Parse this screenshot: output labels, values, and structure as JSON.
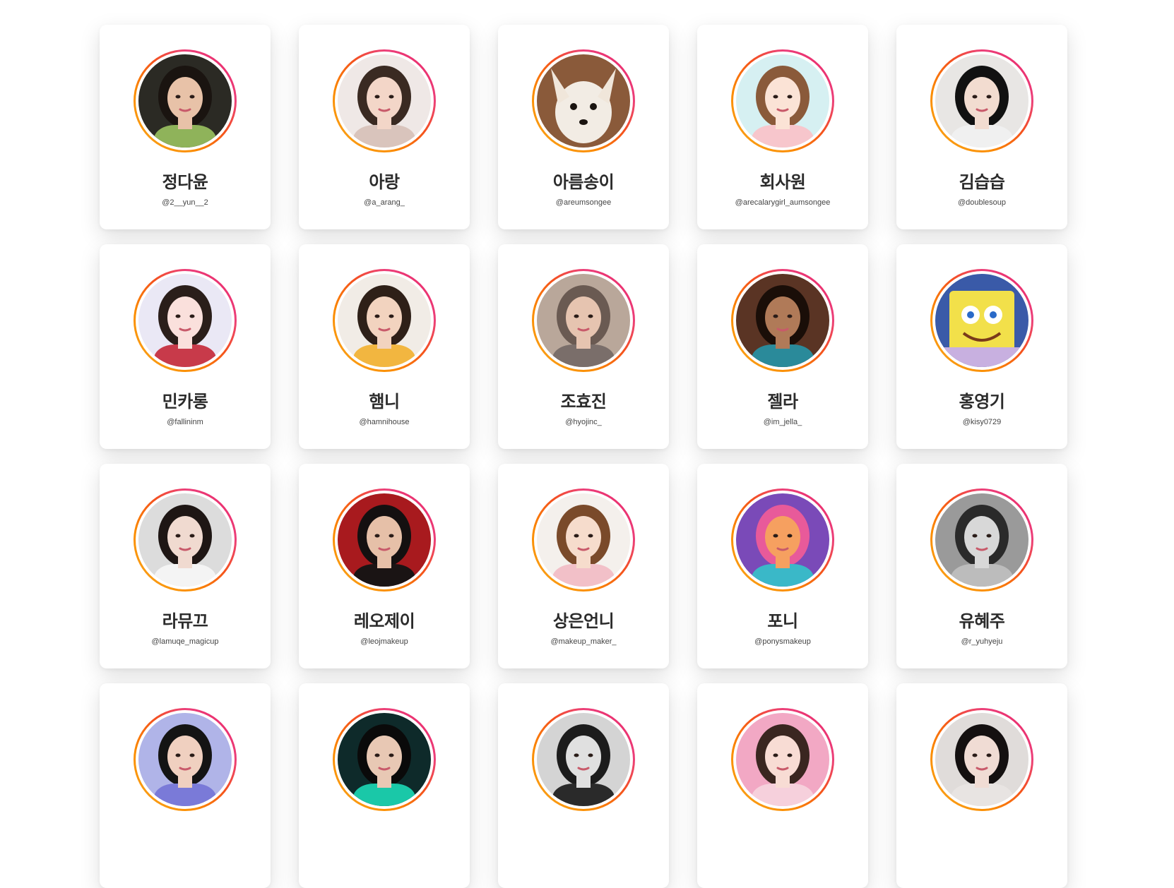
{
  "creators": [
    {
      "name": "정다윤",
      "handle": "@2__yun__2",
      "avatar_icon": "portrait-photo",
      "bg": "#2b2a24",
      "skin": "#e8c2a8",
      "hair": "#1a1410",
      "shirt": "#8fb35a"
    },
    {
      "name": "아랑",
      "handle": "@a_arang_",
      "avatar_icon": "portrait-photo",
      "bg": "#efe8e6",
      "skin": "#f3d6c8",
      "hair": "#3a2a22",
      "shirt": "#d9c4bc"
    },
    {
      "name": "아름송이",
      "handle": "@areumsongee",
      "avatar_icon": "fox-photo",
      "bg": "#8a5a3a",
      "skin": "#f2ece4",
      "hair": "#f0e6da",
      "shirt": "#c99a70"
    },
    {
      "name": "회사원",
      "handle": "@arecalarygirl_aumsongee",
      "avatar_icon": "illustration-portrait",
      "bg": "#d6f0f2",
      "skin": "#fbe3d6",
      "hair": "#8a5a3a",
      "shirt": "#f7c6cc"
    },
    {
      "name": "김습습",
      "handle": "@doublesoup",
      "avatar_icon": "portrait-photo",
      "bg": "#e8e6e4",
      "skin": "#f2dcd0",
      "hair": "#111111",
      "shirt": "#f0f0f0"
    },
    {
      "name": "민카롱",
      "handle": "@fallininm",
      "avatar_icon": "portrait-photo",
      "bg": "#eae8f5",
      "skin": "#fae0dc",
      "hair": "#2a1e1a",
      "shirt": "#c83a4a"
    },
    {
      "name": "햄니",
      "handle": "@hamnihouse",
      "avatar_icon": "portrait-photo",
      "bg": "#f1ece6",
      "skin": "#f2d3bf",
      "hair": "#2e2018",
      "shirt": "#f2b640"
    },
    {
      "name": "조효진",
      "handle": "@hyojinc_",
      "avatar_icon": "portrait-with-dog-photo",
      "bg": "#b9a79a",
      "skin": "#e6c4b0",
      "hair": "#6a5a52",
      "shirt": "#7a6e6a"
    },
    {
      "name": "젤라",
      "handle": "@im_jella_",
      "avatar_icon": "portrait-render",
      "bg": "#5a3424",
      "skin": "#b07a58",
      "hair": "#1a0e08",
      "shirt": "#2a8a9a"
    },
    {
      "name": "홍영기",
      "handle": "@kisy0729",
      "avatar_icon": "cartoon-sponge",
      "bg": "#3a5aa8",
      "skin": "#f2e04a",
      "hair": "#c8a030",
      "shirt": "#c8b0e0"
    },
    {
      "name": "라뮤끄",
      "handle": "@lamuqe_magicup",
      "avatar_icon": "portrait-photo",
      "bg": "#dcdcdc",
      "skin": "#f0dad0",
      "hair": "#1e1614",
      "shirt": "#f4f4f4"
    },
    {
      "name": "레오제이",
      "handle": "@leojmakeup",
      "avatar_icon": "portrait-photo",
      "bg": "#a81a1e",
      "skin": "#e6c0a8",
      "hair": "#141010",
      "shirt": "#1a1414"
    },
    {
      "name": "상은언니",
      "handle": "@makeup_maker_",
      "avatar_icon": "portrait-photo",
      "bg": "#f4f0ec",
      "skin": "#f6dccc",
      "hair": "#7a4a2a",
      "shirt": "#f2c0c8"
    },
    {
      "name": "포니",
      "handle": "@ponysmakeup",
      "avatar_icon": "illustration-portrait",
      "bg": "#7a4ab8",
      "skin": "#f6a060",
      "hair": "#e85a9a",
      "shirt": "#3ab8c8"
    },
    {
      "name": "유혜주",
      "handle": "@r_yuhyeju",
      "avatar_icon": "portrait-photo-bw",
      "bg": "#9a9a9a",
      "skin": "#d8d8d8",
      "hair": "#2a2a2a",
      "shirt": "#bcbcbc"
    },
    {
      "name": "",
      "handle": "",
      "avatar_icon": "portrait-render",
      "bg": "#b0b4e8",
      "skin": "#f0d0c0",
      "hair": "#141414",
      "shirt": "#7a7ad8"
    },
    {
      "name": "",
      "handle": "",
      "avatar_icon": "portrait-render",
      "bg": "#0e2a2a",
      "skin": "#e8c8b4",
      "hair": "#0a0a0a",
      "shirt": "#1ac8a8"
    },
    {
      "name": "",
      "handle": "",
      "avatar_icon": "portrait-photo-bw",
      "bg": "#d4d4d4",
      "skin": "#e0e0e0",
      "hair": "#1c1c1c",
      "shirt": "#2a2a2a"
    },
    {
      "name": "",
      "handle": "",
      "avatar_icon": "portrait-photo",
      "bg": "#f2a8c4",
      "skin": "#f8dcd4",
      "hair": "#3a2620",
      "shirt": "#f6d0dc"
    },
    {
      "name": "",
      "handle": "",
      "avatar_icon": "portrait-photo",
      "bg": "#e0dcda",
      "skin": "#f0dcd4",
      "hair": "#141010",
      "shirt": "#e8e4e2"
    }
  ]
}
